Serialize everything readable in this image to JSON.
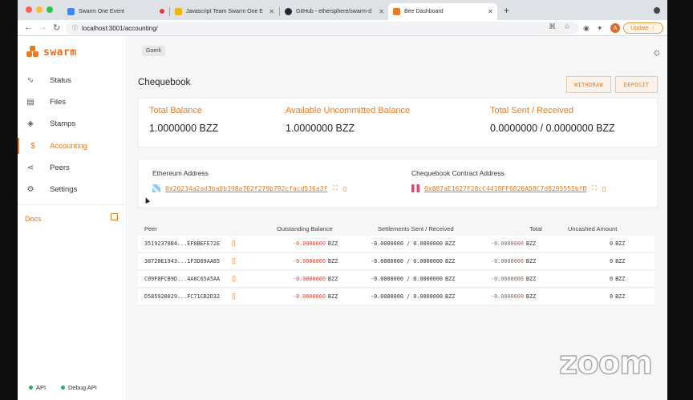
{
  "browser": {
    "tabs": [
      {
        "title": "Swarm One Event",
        "favicon_color": "#4285f4"
      },
      {
        "title": "Javascript Team Swarm One E",
        "favicon_color": "#f4b400"
      },
      {
        "title": "GitHub - ethersphere/swarm-d",
        "favicon_color": "#24292e"
      },
      {
        "title": "Bee Dashboard",
        "favicon_color": "#ea7a1e",
        "active": true
      }
    ],
    "url": "localhost:3001/accounting/",
    "avatar_letter": "A",
    "update_label": "Update"
  },
  "brand": {
    "name": "swarm",
    "color": "#ea7a1e"
  },
  "sidebar": {
    "items": [
      {
        "label": "Status",
        "icon": "activity-icon"
      },
      {
        "label": "Files",
        "icon": "file-icon"
      },
      {
        "label": "Stamps",
        "icon": "layers-icon"
      },
      {
        "label": "Accounting",
        "icon": "dollar-icon",
        "active": true
      },
      {
        "label": "Peers",
        "icon": "share-icon"
      },
      {
        "label": "Settings",
        "icon": "gear-icon"
      }
    ],
    "docs_label": "Docs",
    "status": [
      {
        "label": "API",
        "state": "ok"
      },
      {
        "label": "Debug API",
        "state": "ok"
      }
    ]
  },
  "header": {
    "network": "Goerli"
  },
  "chequebook": {
    "title": "Chequebook",
    "withdraw_label": "WITHDRAW",
    "deposit_label": "DEPOSIT",
    "stats": [
      {
        "label": "Total Balance",
        "value": "1.0000000 BZZ"
      },
      {
        "label": "Available Uncommitted Balance",
        "value": "1.0000000 BZZ"
      },
      {
        "label": "Total Sent / Received",
        "value": "0.0000000 / 0.0000000 BZZ"
      }
    ],
    "ethereum_address_label": "Ethereum Address",
    "ethereum_address": "0x26234a2ad3ba8b398a762f279b792cfacd536a3f",
    "contract_address_label": "Chequebook Contract Address",
    "contract_address": "0x887aE1627F28cC4418FF6826A58C7d8295555bfB"
  },
  "peers_table": {
    "columns": [
      "Peer",
      "Outstanding Balance",
      "Settlements Sent / Received",
      "Total",
      "Uncashed Amount"
    ],
    "unit": "BZZ",
    "rows": [
      {
        "peer": "35192378B4...EF0BEFE72E",
        "outstanding": "-0.0000000",
        "settlements": "-0.0000000 / 0.0000000",
        "total": "-0.0000000",
        "uncashed": "0"
      },
      {
        "peer": "38720E1943...1F3D09AA85",
        "outstanding": "-0.0000000",
        "settlements": "-0.0000000 / 0.0000000",
        "total": "-0.0000000",
        "uncashed": "0"
      },
      {
        "peer": "C09F0FCB9D...4A8C65A5AA",
        "outstanding": "-0.0000000",
        "settlements": "-0.0000000 / 0.0000000",
        "total": "-0.0000000",
        "uncashed": "0"
      },
      {
        "peer": "D585920029...FC71CB2D32",
        "outstanding": "-0.0000000",
        "settlements": "-0.0000000 / 0.0000000",
        "total": "-0.0000000",
        "uncashed": "0"
      }
    ]
  },
  "watermark": "zoom"
}
